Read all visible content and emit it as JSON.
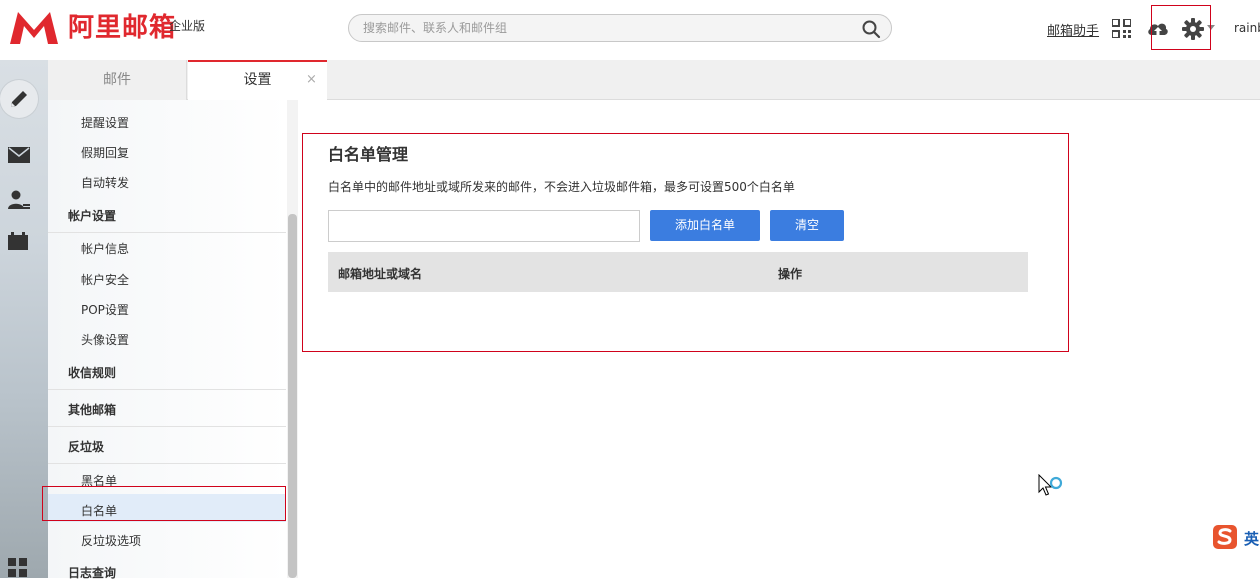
{
  "header": {
    "logo_text": "阿里邮箱",
    "edition": "企业版",
    "search_placeholder": "搜索邮件、联系人和邮件组",
    "helper_link": "邮箱助手",
    "username": "rainb"
  },
  "tabs": [
    {
      "label": "邮件"
    },
    {
      "label": "设置",
      "active": true,
      "close": "×"
    }
  ],
  "sidebar": {
    "items": [
      {
        "label": "提醒设置"
      },
      {
        "label": "假期回复"
      },
      {
        "label": "自动转发"
      }
    ],
    "groups": [
      {
        "label": "帐户设置",
        "items": [
          "帐户信息",
          "帐户安全",
          "POP设置",
          "头像设置"
        ]
      },
      {
        "label": "收信规则"
      },
      {
        "label": "其他邮箱"
      },
      {
        "label": "反垃圾",
        "items": [
          "黑名单",
          "白名单",
          "反垃圾选项"
        ]
      },
      {
        "label": "日志查询"
      }
    ],
    "selected": "白名单"
  },
  "main": {
    "title": "白名单管理",
    "description": "白名单中的邮件地址或域所发来的邮件，不会进入垃圾邮件箱，最多可设置500个白名单",
    "input_value": "",
    "add_button": "添加白名单",
    "clear_button": "清空",
    "table_headers": [
      "邮箱地址或域名",
      "操作"
    ]
  },
  "icons": [
    "logo-m-icon",
    "search-icon",
    "qr-code-icon",
    "cloud-upload-icon",
    "gear-icon",
    "compose-icon",
    "mail-icon",
    "contacts-icon",
    "calendar-icon",
    "apps-icon",
    "cursor-icon",
    "ime-icon"
  ],
  "colors": {
    "brand_red": "#e0282e",
    "button_blue": "#3b7de0",
    "annotation_red": "#d0021b",
    "selected_bg": "#e1ecf9"
  },
  "ime": {
    "label": "英"
  }
}
